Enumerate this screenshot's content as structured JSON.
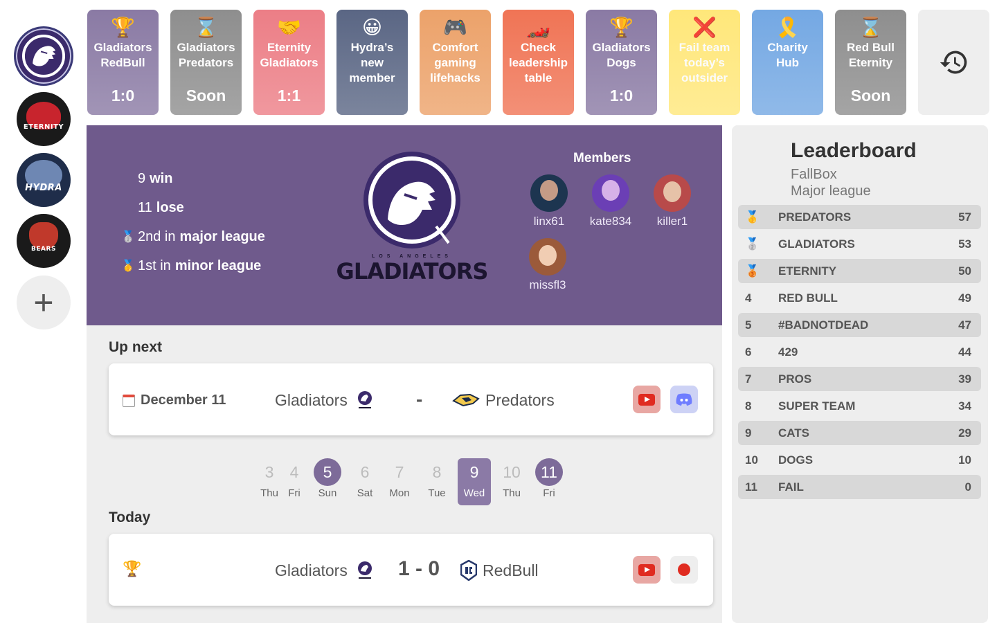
{
  "sidebar": {
    "teams": [
      {
        "name": "Gladiators",
        "tag": "",
        "color": "#3b2a6b"
      },
      {
        "name": "Eternity",
        "tag": "ETERNITY",
        "color": "#1a1a1a"
      },
      {
        "name": "Hydra",
        "tag": "HYDRA",
        "color": "#1f2d4a"
      },
      {
        "name": "Bears",
        "tag": "BEARS",
        "color": "#1a1a1a"
      }
    ],
    "add_label": "+"
  },
  "cards": [
    {
      "icon": "🏆",
      "icon_name": "trophy-icon",
      "title_1": "Gladiators",
      "title_2": "RedBull",
      "title_3": "",
      "score": "1:0",
      "bg": "#8a7aa4",
      "text": "#ffffff"
    },
    {
      "icon": "⌛",
      "icon_name": "hourglass-icon",
      "title_1": "Gladiators",
      "title_2": "Predators",
      "title_3": "",
      "score": "Soon",
      "bg": "#8e8e8e",
      "text": "#ffffff"
    },
    {
      "icon": "🤝",
      "icon_name": "handshake-icon",
      "title_1": "Eternity",
      "title_2": "Gladiators",
      "title_3": "",
      "score": "1:1",
      "bg": "#ec7e86",
      "text": "#ffffff"
    },
    {
      "icon": "😀",
      "icon_name": "smiley-icon",
      "title_1": "Hydra’s",
      "title_2": "new",
      "title_3": "member",
      "score": "",
      "bg": "#5a6684",
      "text": "#ffffff"
    },
    {
      "icon": "🎮",
      "icon_name": "gamepad-icon",
      "title_1": "Comfort",
      "title_2": "gaming",
      "title_3": "lifehacks",
      "score": "",
      "bg": "#eca26a",
      "text": "#ffffff"
    },
    {
      "icon": "🏎️",
      "icon_name": "race-car-icon",
      "title_1": "Check",
      "title_2": "leadership",
      "title_3": "table",
      "score": "",
      "bg": "#f07455",
      "text": "#ffffff"
    },
    {
      "icon": "🏆",
      "icon_name": "trophy-icon",
      "title_1": "Gladiators",
      "title_2": "Dogs",
      "title_3": "",
      "score": "1:0",
      "bg": "#8a7aa4",
      "text": "#ffffff"
    },
    {
      "icon": "❌",
      "icon_name": "cross-icon",
      "title_1": "Fail team",
      "title_2": "today’s",
      "title_3": "outsider",
      "score": "",
      "bg": "#ffe77a",
      "text": "#fbfbfb"
    },
    {
      "icon": "🎗️",
      "icon_name": "ribbon-icon",
      "title_1": "Charity",
      "title_2": "Hub",
      "title_3": "",
      "score": "",
      "bg": "#74a8e3",
      "text": "#ffffff"
    },
    {
      "icon": "⌛",
      "icon_name": "hourglass-icon",
      "title_1": "Red Bull",
      "title_2": "Eternity",
      "title_3": "",
      "score": "Soon",
      "bg": "#8e8e8e",
      "text": "#ffffff"
    }
  ],
  "history_icon": "history-icon",
  "hero": {
    "stats": [
      {
        "medal": "",
        "num": "9",
        "label": "win"
      },
      {
        "medal": "",
        "num": "11",
        "label": "lose"
      },
      {
        "medal": "🥈",
        "num": "2nd in",
        "label": "major league"
      },
      {
        "medal": "🥇",
        "num": "1st in",
        "label": "minor league"
      }
    ],
    "logo_sub": "LOS ANGELES",
    "logo_word": "GLADIATORS",
    "members_title": "Members",
    "members": [
      "linx61",
      "kate834",
      "killer1",
      "missfl3"
    ]
  },
  "up_next": {
    "title": "Up next",
    "date": "December 11",
    "team_a": "Gladiators",
    "separator": "-",
    "team_b": "Predators"
  },
  "days": [
    {
      "num": "3",
      "label": "Thu",
      "style": "plain"
    },
    {
      "num": "4",
      "label": "Fri",
      "style": "plain"
    },
    {
      "num": "5",
      "label": "Sun",
      "style": "circle"
    },
    {
      "num": "6",
      "label": "Sat",
      "style": "plain"
    },
    {
      "num": "7",
      "label": "Mon",
      "style": "plain"
    },
    {
      "num": "8",
      "label": "Tue",
      "style": "plain"
    },
    {
      "num": "9",
      "label": "Wed",
      "style": "selected"
    },
    {
      "num": "10",
      "label": "Thu",
      "style": "plain"
    },
    {
      "num": "11",
      "label": "Fri",
      "style": "circle"
    }
  ],
  "today": {
    "title": "Today",
    "team_a": "Gladiators",
    "score": "1 - 0",
    "team_b": "RedBull"
  },
  "leaderboard": {
    "title": "Leaderboard",
    "subtitle_1": "FallBox",
    "subtitle_2": "Major league",
    "rows": [
      {
        "rank": "🥇",
        "name": "PREDATORS",
        "points": "57"
      },
      {
        "rank": "🥈",
        "name": "GLADIATORS",
        "points": "53"
      },
      {
        "rank": "🥉",
        "name": "ETERNITY",
        "points": "50"
      },
      {
        "rank": "4",
        "name": "RED BULL",
        "points": "49"
      },
      {
        "rank": "5",
        "name": "#BADNOTDEAD",
        "points": "47"
      },
      {
        "rank": "6",
        "name": "429",
        "points": "44"
      },
      {
        "rank": "7",
        "name": "PROS",
        "points": "39"
      },
      {
        "rank": "8",
        "name": "SUPER TEAM",
        "points": "34"
      },
      {
        "rank": "9",
        "name": "CATS",
        "points": "29"
      },
      {
        "rank": "10",
        "name": "DOGS",
        "points": "10"
      },
      {
        "rank": "11",
        "name": "FAIL",
        "points": "0"
      }
    ]
  }
}
